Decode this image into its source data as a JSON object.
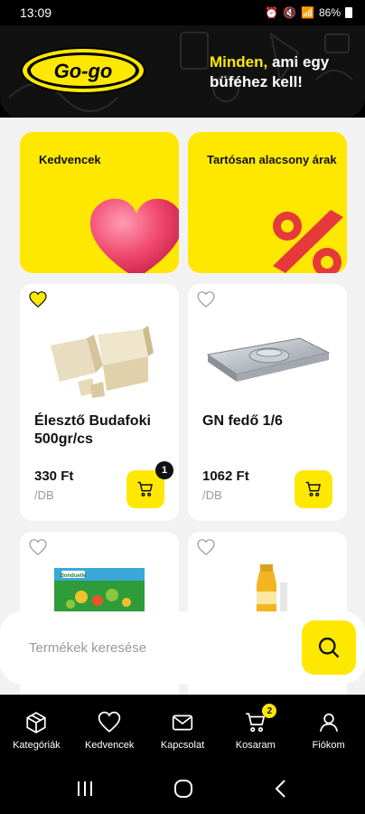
{
  "status_bar": {
    "time": "13:09",
    "battery": "86%"
  },
  "header": {
    "logo_text": "Go-go",
    "tagline_highlight": "Minden,",
    "tagline_rest": " ami egy büféhez kell!"
  },
  "promos": [
    {
      "title": "Kedvencek"
    },
    {
      "title": "Tartósan alacsony árak"
    }
  ],
  "products": [
    {
      "name": "Élesztő Budafoki 500gr/cs",
      "price": "330 Ft",
      "unit": "/DB",
      "favorite": true,
      "cart_qty": "1"
    },
    {
      "name": "GN fedő 1/6",
      "price": "1062 Ft",
      "unit": "/DB",
      "favorite": false,
      "cart_qty": ""
    },
    {
      "name": "",
      "price": "",
      "unit": "",
      "favorite": false,
      "cart_qty": "",
      "image_brand": "Bonduelle"
    },
    {
      "name": "",
      "price": "",
      "unit": "",
      "favorite": false,
      "cart_qty": ""
    }
  ],
  "search": {
    "placeholder": "Termékek keresése",
    "value": ""
  },
  "bottom_nav": [
    {
      "label": "Kategóriák",
      "icon": "box-icon"
    },
    {
      "label": "Kedvencek",
      "icon": "heart-icon"
    },
    {
      "label": "Kapcsolat",
      "icon": "mail-icon"
    },
    {
      "label": "Kosaram",
      "icon": "cart-icon",
      "badge": "2"
    },
    {
      "label": "Fiókom",
      "icon": "user-icon"
    }
  ],
  "colors": {
    "accent": "#FFE800",
    "dark": "#111111",
    "background": "#F2F2F2"
  }
}
